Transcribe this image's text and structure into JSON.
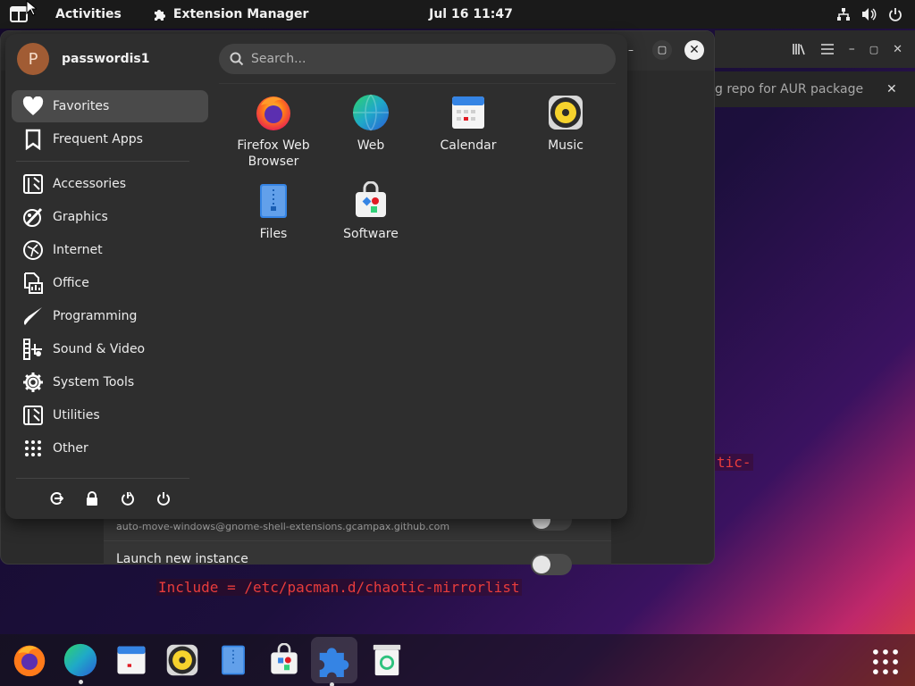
{
  "topbar": {
    "activities": "Activities",
    "focused_app": "Extension Manager",
    "clock": "Jul 16  11:47",
    "tray_icons": [
      "network-icon",
      "volume-icon",
      "power-icon"
    ]
  },
  "app_menu": {
    "user": {
      "initial": "P",
      "name": "passwordis1"
    },
    "search": {
      "placeholder": "Search..."
    },
    "categories": [
      {
        "label": "Favorites",
        "icon": "heart-icon",
        "active": true
      },
      {
        "label": "Frequent Apps",
        "icon": "bookmark-icon"
      },
      {
        "label": "Accessories",
        "icon": "accessories-icon"
      },
      {
        "label": "Graphics",
        "icon": "graphics-icon"
      },
      {
        "label": "Internet",
        "icon": "internet-icon"
      },
      {
        "label": "Office",
        "icon": "office-icon"
      },
      {
        "label": "Programming",
        "icon": "programming-icon"
      },
      {
        "label": "Sound & Video",
        "icon": "sound-video-icon"
      },
      {
        "label": "System Tools",
        "icon": "gear-icon"
      },
      {
        "label": "Utilities",
        "icon": "utilities-icon"
      },
      {
        "label": "Other",
        "icon": "grid-icon"
      }
    ],
    "apps": [
      {
        "label": "Firefox Web Browser",
        "line1": "Firefox Web",
        "line2": "Browser",
        "icon": "firefox-icon"
      },
      {
        "label": "Web",
        "icon": "web-icon"
      },
      {
        "label": "Calendar",
        "icon": "calendar-icon"
      },
      {
        "label": "Music",
        "icon": "music-icon"
      },
      {
        "label": "Files",
        "icon": "files-icon"
      },
      {
        "label": "Software",
        "icon": "software-icon"
      }
    ],
    "session_buttons": [
      "logout-icon",
      "lock-icon",
      "restart-icon",
      "power-off-icon"
    ]
  },
  "background": {
    "extension_id": "auto-move-windows@gnome-shell-extensions.gcampax.github.com",
    "extension_next": "Launch new instance",
    "terminal_tab": "g repo for AUR packages",
    "terminal_line_1": "tic-",
    "terminal_line_2": "Include = /etc/pacman.d/chaotic-mirrorlist"
  },
  "dock": {
    "items": [
      {
        "name": "firefox",
        "running": false
      },
      {
        "name": "web",
        "running": true
      },
      {
        "name": "calendar",
        "running": false
      },
      {
        "name": "music",
        "running": false
      },
      {
        "name": "files",
        "running": false
      },
      {
        "name": "software",
        "running": false
      },
      {
        "name": "extension-manager",
        "running": true,
        "focused": true
      },
      {
        "name": "trash",
        "running": false
      }
    ]
  },
  "colors": {
    "accent": "#3584e4",
    "menu_bg": "#2e2e2e",
    "terminal_red": "#e83c3c"
  }
}
